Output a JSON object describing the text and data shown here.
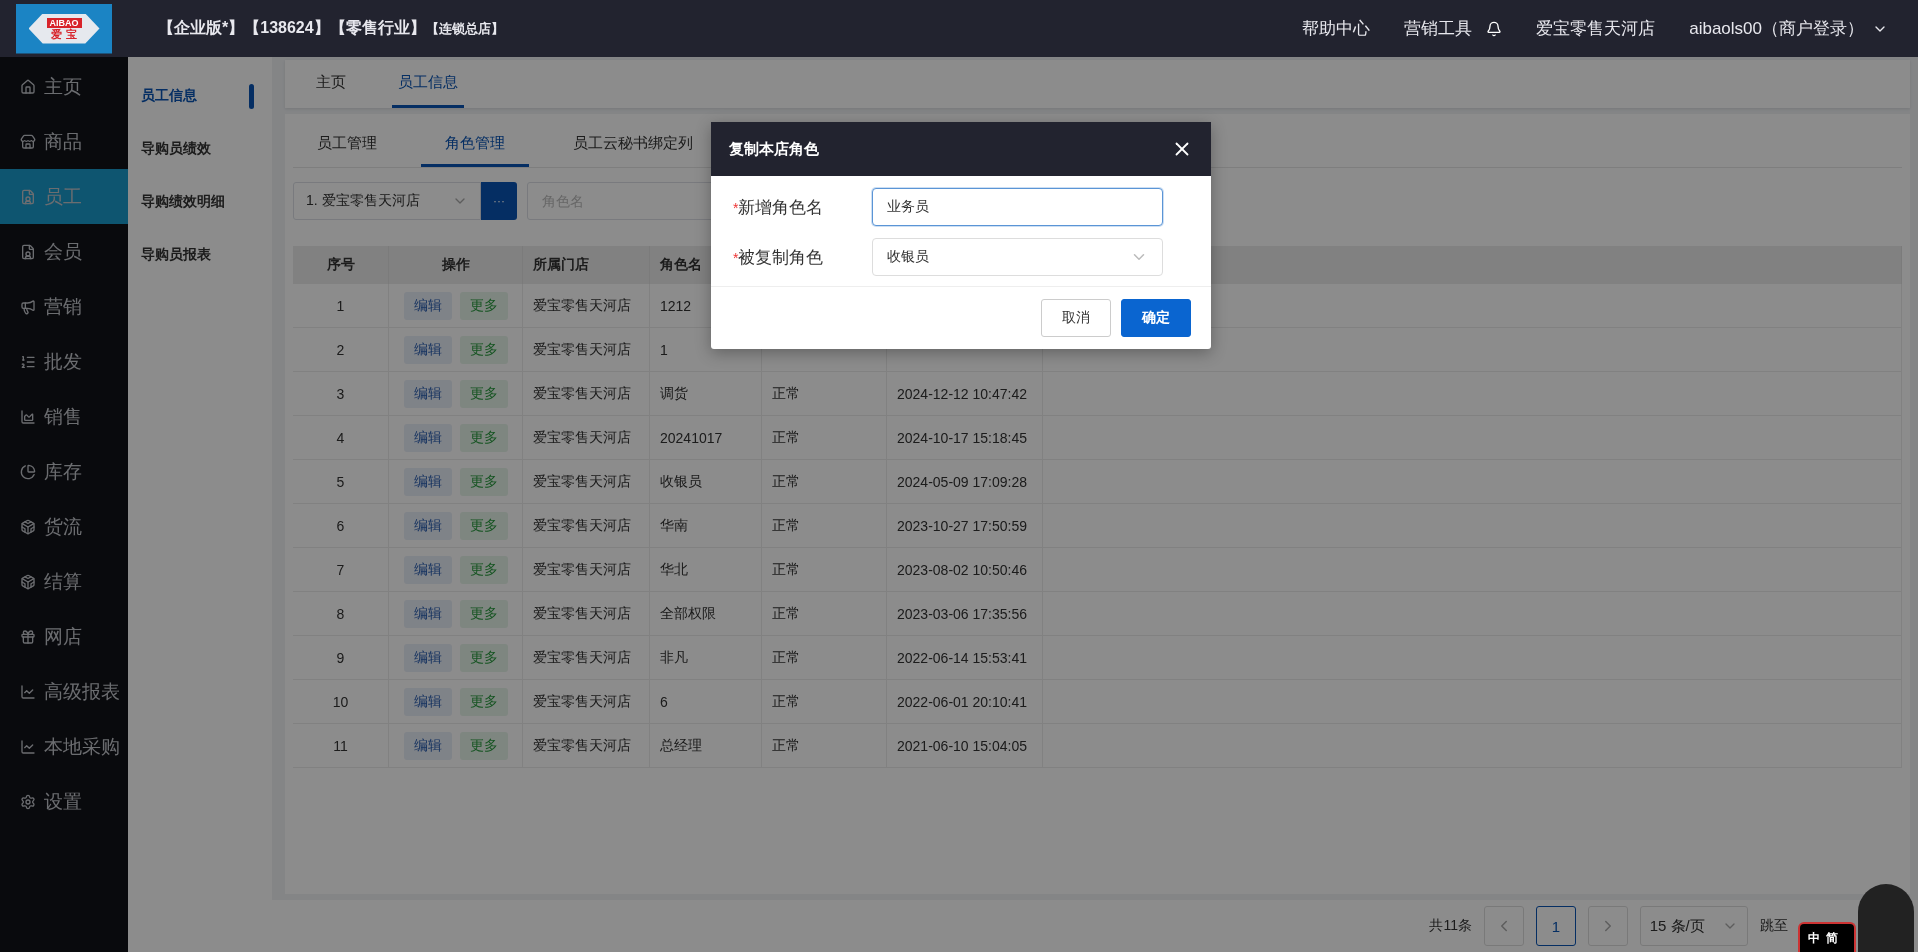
{
  "header": {
    "logo_top": "AIBAO",
    "logo_bottom": "爱 宝",
    "edition": "【企业版*】",
    "account_id": "【138624】",
    "industry": "【零售行业】",
    "store_type": "【连锁总店】",
    "links": [
      "帮助中心",
      "营销工具"
    ],
    "store": "爱宝零售天河店",
    "user": "aibaols00（商户登录）"
  },
  "sidebar": {
    "items": [
      {
        "label": "主页",
        "selected": false
      },
      {
        "label": "商品",
        "selected": false
      },
      {
        "label": "员工",
        "selected": true
      },
      {
        "label": "会员",
        "selected": false
      },
      {
        "label": "营销",
        "selected": false
      },
      {
        "label": "批发",
        "selected": false
      },
      {
        "label": "销售",
        "selected": false
      },
      {
        "label": "库存",
        "selected": false
      },
      {
        "label": "货流",
        "selected": false
      },
      {
        "label": "结算",
        "selected": false
      },
      {
        "label": "网店",
        "selected": false
      },
      {
        "label": "高级报表",
        "selected": false
      },
      {
        "label": "本地采购",
        "selected": false
      },
      {
        "label": "设置",
        "selected": false
      }
    ]
  },
  "submenu": {
    "items": [
      {
        "label": "员工信息",
        "selected": true
      },
      {
        "label": "导购员绩效",
        "selected": false
      },
      {
        "label": "导购绩效明细",
        "selected": false
      },
      {
        "label": "导购员报表",
        "selected": false
      }
    ]
  },
  "page_tabs": [
    {
      "label": "主页",
      "selected": false
    },
    {
      "label": "员工信息",
      "selected": true
    }
  ],
  "sub_tabs": [
    {
      "label": "员工管理",
      "selected": false
    },
    {
      "label": "角色管理",
      "selected": true
    },
    {
      "label": "员工云秘书绑定列",
      "selected": false
    }
  ],
  "filter": {
    "store": "1. 爱宝零售天河店",
    "more_button": "···",
    "role_placeholder": "角色名"
  },
  "table": {
    "columns": [
      "序号",
      "操作",
      "所属门店",
      "角色名"
    ],
    "rows": [
      {
        "no": "1",
        "actions": [
          "编辑",
          "更多"
        ],
        "store": "爱宝零售天河店",
        "role": "1212"
      },
      {
        "no": "2",
        "actions": [
          "编辑",
          "更多"
        ],
        "store": "爱宝零售天河店",
        "role": "1"
      },
      {
        "no": "3",
        "actions": [
          "编辑",
          "更多"
        ],
        "store": "爱宝零售天河店",
        "role": "调货",
        "status": "正常",
        "created": "2024-12-12 10:47:42"
      },
      {
        "no": "4",
        "actions": [
          "编辑",
          "更多"
        ],
        "store": "爱宝零售天河店",
        "role": "20241017",
        "status": "正常",
        "created": "2024-10-17 15:18:45"
      },
      {
        "no": "5",
        "actions": [
          "编辑",
          "更多"
        ],
        "store": "爱宝零售天河店",
        "role": "收银员",
        "status": "正常",
        "created": "2024-05-09 17:09:28"
      },
      {
        "no": "6",
        "actions": [
          "编辑",
          "更多"
        ],
        "store": "爱宝零售天河店",
        "role": "华南",
        "status": "正常",
        "created": "2023-10-27 17:50:59"
      },
      {
        "no": "7",
        "actions": [
          "编辑",
          "更多"
        ],
        "store": "爱宝零售天河店",
        "role": "华北",
        "status": "正常",
        "created": "2023-08-02 10:50:46"
      },
      {
        "no": "8",
        "actions": [
          "编辑",
          "更多"
        ],
        "store": "爱宝零售天河店",
        "role": "全部权限",
        "status": "正常",
        "created": "2023-03-06 17:35:56"
      },
      {
        "no": "9",
        "actions": [
          "编辑",
          "更多"
        ],
        "store": "爱宝零售天河店",
        "role": "非凡",
        "status": "正常",
        "created": "2022-06-14 15:53:41"
      },
      {
        "no": "10",
        "actions": [
          "编辑",
          "更多"
        ],
        "store": "爱宝零售天河店",
        "role": "6",
        "status": "正常",
        "created": "2022-06-01 20:10:41"
      },
      {
        "no": "11",
        "actions": [
          "编辑",
          "更多"
        ],
        "store": "爱宝零售天河店",
        "role": "总经理",
        "status": "正常",
        "created": "2021-06-10 15:04:05"
      }
    ]
  },
  "pagination": {
    "total": "共11条",
    "pages": [
      {
        "label": "1",
        "selected": true
      }
    ],
    "page_size": "15 条/页",
    "jump_label": "跳至"
  },
  "dialog": {
    "title": "复制本店角色",
    "fields": [
      {
        "label": "新增角色名",
        "required_mark": "*",
        "kind": "input",
        "value": "业务员"
      },
      {
        "label": "被复制角色",
        "required_mark": "*",
        "kind": "select",
        "value": "收银员"
      }
    ],
    "buttons": [
      {
        "label": "取消",
        "kind": "secondary"
      },
      {
        "label": "确定",
        "kind": "primary"
      }
    ]
  },
  "ime_widget": {
    "labels": [
      "中",
      "简"
    ]
  }
}
